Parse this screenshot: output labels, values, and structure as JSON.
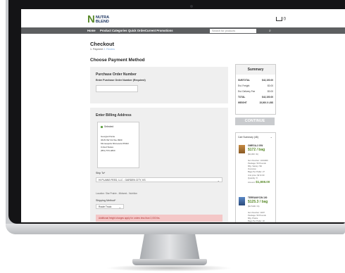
{
  "header": {
    "logo_mark": "N",
    "logo_line1": "NUTRA",
    "logo_line2": "BLEND",
    "cart_count": "0"
  },
  "nav": {
    "items": [
      "Home",
      "Product Categories",
      "Quick Order",
      "Current Promotions"
    ],
    "search_placeholder": "Search for products",
    "search_icon": "search-icon"
  },
  "page": {
    "title": "Checkout",
    "step1": "1. Payment",
    "step_sep": "  ",
    "step2": "2. Review",
    "section_title": "Choose Payment Method"
  },
  "po": {
    "title": "Purchase Order Number",
    "label": "Enter Purchase Order Number (Required)",
    "value": ""
  },
  "billing": {
    "title": "Enter Billing Address",
    "selected_label": "Selected",
    "address_lines": [
      "Georgia Prairie",
      "3615 NW 3rd Ste 9999",
      "Minneapolis Minnesota 55402",
      "United States",
      "(851) 573-4800"
    ],
    "ship_to_label": "Ship To*",
    "ship_to_value": "HI PLAINS FEED, LLC - GARDEN CITY, KS",
    "location_text": "Location: Star Prairie - Midwest - Nutrition",
    "shipping_method_label": "Shipping Method*",
    "shipping_method_value": "Route Truck",
    "alert": "Additional freight charges apply for orders less than 2,000 lbs."
  },
  "summary": {
    "title": "Summary",
    "rows": [
      {
        "label": "SUBTOTAL",
        "value": "$42,150.00",
        "bold": true
      },
      {
        "label": "Est. Freight",
        "value": "$0.00",
        "bold": false
      },
      {
        "label": "Est. Delivery Fee",
        "value": "$0.00",
        "bold": false
      },
      {
        "label": "TOTAL",
        "value": "$42,150.00",
        "bold": true
      },
      {
        "label": "WEIGHT",
        "value": "15,000.0 LBS",
        "bold": true
      }
    ],
    "continue_label": "CONTINUE"
  },
  "cart": {
    "header": "Cart Summary (48)",
    "items": [
      {
        "name": "OMEGA-3 GW",
        "price": "$172 / bag",
        "sub": "($4,300 / lb)",
        "details": [
          "Item Number: 1001000",
          "Package: 50 Pounds",
          "Mfg. Variety: 5ib",
          "Overview",
          "Bags Per Pallet: 27"
        ],
        "unit_price": "Unit price: $172.00",
        "quantity": "Quantity: 8",
        "amount_label": "Amount:",
        "amount": "$1,808.00"
      },
      {
        "name": "TERRAMYCIN 100",
        "price": "$125.3 / bag",
        "sub": "($2.5100 / lb)",
        "details": [
          "Item Number: 2007",
          "Package: 50 Pounds",
          "Mfg. Prairie",
          "Bags Per Pallet: 40"
        ]
      }
    ]
  }
}
